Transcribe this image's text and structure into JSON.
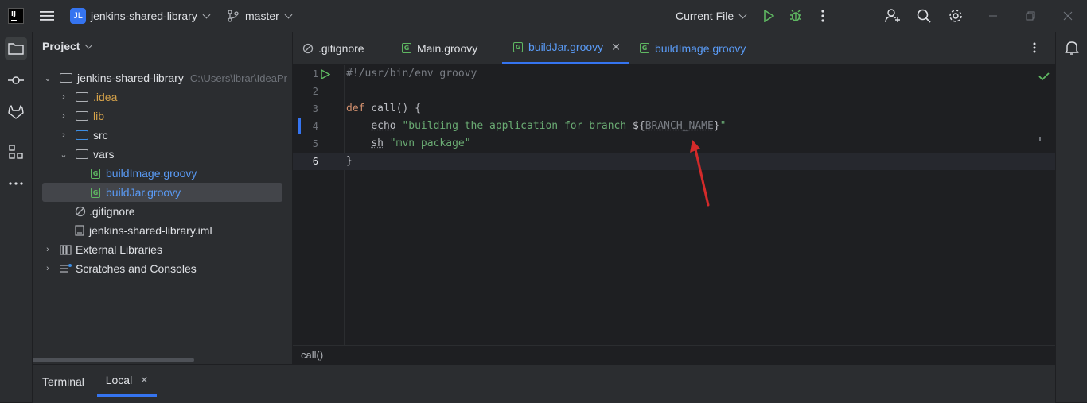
{
  "titlebar": {
    "project_initials": "JL",
    "project_name": "jenkins-shared-library",
    "branch": "master",
    "run_config": "Current File"
  },
  "project_panel": {
    "title": "Project",
    "root": {
      "name": "jenkins-shared-library",
      "path": "C:\\Users\\lbrar\\IdeaPr"
    },
    "items": [
      {
        "label": ".idea"
      },
      {
        "label": "lib"
      },
      {
        "label": "src"
      },
      {
        "label": "vars"
      },
      {
        "label": "buildImage.groovy"
      },
      {
        "label": "buildJar.groovy"
      },
      {
        "label": ".gitignore"
      },
      {
        "label": "jenkins-shared-library.iml"
      },
      {
        "label": "External Libraries"
      },
      {
        "label": "Scratches and Consoles"
      }
    ]
  },
  "editor": {
    "tabs": [
      {
        "label": ".gitignore"
      },
      {
        "label": "Main.groovy"
      },
      {
        "label": "buildJar.groovy"
      },
      {
        "label": "buildImage.groovy"
      }
    ],
    "line_numbers": [
      "1",
      "2",
      "3",
      "4",
      "5",
      "6"
    ],
    "code": {
      "l1": "#!/usr/bin/env groovy",
      "l3_kw": "def",
      "l3_rest": " call() {",
      "l4_cmd": "echo",
      "l4_str1": "\"building the application for branch ",
      "l4_interp_open": "${",
      "l4_var": "BRANCH_NAME",
      "l4_interp_close": "}",
      "l4_str2": "\"",
      "l5_cmd": "sh",
      "l5_str": "\"mvn package\"",
      "l6": "}"
    },
    "breadcrumb": "call()"
  },
  "bottom": {
    "terminal_label": "Terminal",
    "local_tab": "Local"
  },
  "colors": {
    "accent": "#3574f0",
    "keyword": "#cf8e6d",
    "string": "#6aab73",
    "annotation_arrow": "#d42a2a"
  }
}
